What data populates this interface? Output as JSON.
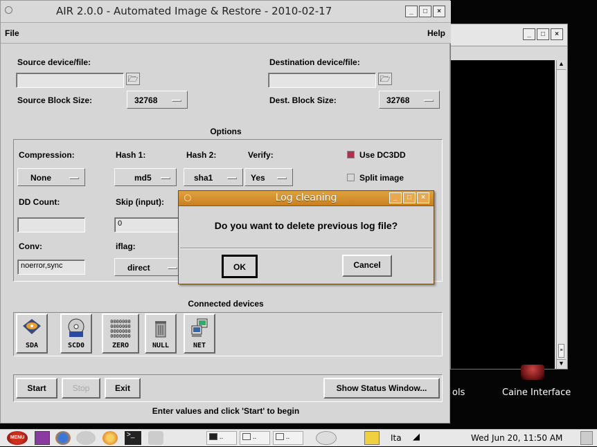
{
  "window": {
    "title": "AIR 2.0.0 - Automated Image & Restore - 2010-02-17"
  },
  "menu": {
    "file": "File",
    "help": "Help"
  },
  "source": {
    "label": "Source device/file:",
    "value": "",
    "block_size_label": "Source Block Size:",
    "block_size": "32768"
  },
  "destination": {
    "label": "Destination device/file:",
    "value": "",
    "block_size_label": "Dest. Block Size:",
    "block_size": "32768"
  },
  "options": {
    "heading": "Options",
    "compression_label": "Compression:",
    "compression": "None",
    "hash1_label": "Hash 1:",
    "hash1": "md5",
    "hash2_label": "Hash 2:",
    "hash2": "sha1",
    "verify_label": "Verify:",
    "verify": "Yes",
    "use_dc3dd": "Use DC3DD",
    "use_dc3dd_checked": true,
    "split_image": "Split image",
    "split_image_checked": false,
    "dd_count_label": "DD Count:",
    "dd_count": "",
    "skip_label": "Skip (input):",
    "skip": "0",
    "conv_label": "Conv:",
    "conv": "noerror,sync",
    "iflag_label": "iflag:",
    "iflag": "direct"
  },
  "devices": {
    "heading": "Connected devices",
    "items": [
      {
        "label": "SDA",
        "icon": "harddisk-icon"
      },
      {
        "label": "SCD0",
        "icon": "cdrom-icon"
      },
      {
        "label": "ZERO",
        "icon": "zero-icon"
      },
      {
        "label": "NULL",
        "icon": "trash-icon"
      },
      {
        "label": "NET",
        "icon": "network-icon"
      }
    ]
  },
  "actions": {
    "start": "Start",
    "stop": "Stop",
    "exit": "Exit",
    "status_window": "Show Status Window...",
    "status_text": "Enter values and click 'Start' to begin"
  },
  "dialog": {
    "title": "Log cleaning",
    "message": "Do you want to delete previous log file?",
    "ok": "OK",
    "cancel": "Cancel"
  },
  "desktop": {
    "label_left": "ols",
    "label_right": "Caine Interface"
  },
  "taskbar": {
    "menu": "MENU",
    "task1": "..",
    "task2": "..",
    "task3": "..",
    "lang": "Ita",
    "clock": "Wed Jun 20, 11:50 AM"
  },
  "colors": {
    "dialog_title": "#d18b2a",
    "checked": "#b03050",
    "desktop": "#000000"
  }
}
